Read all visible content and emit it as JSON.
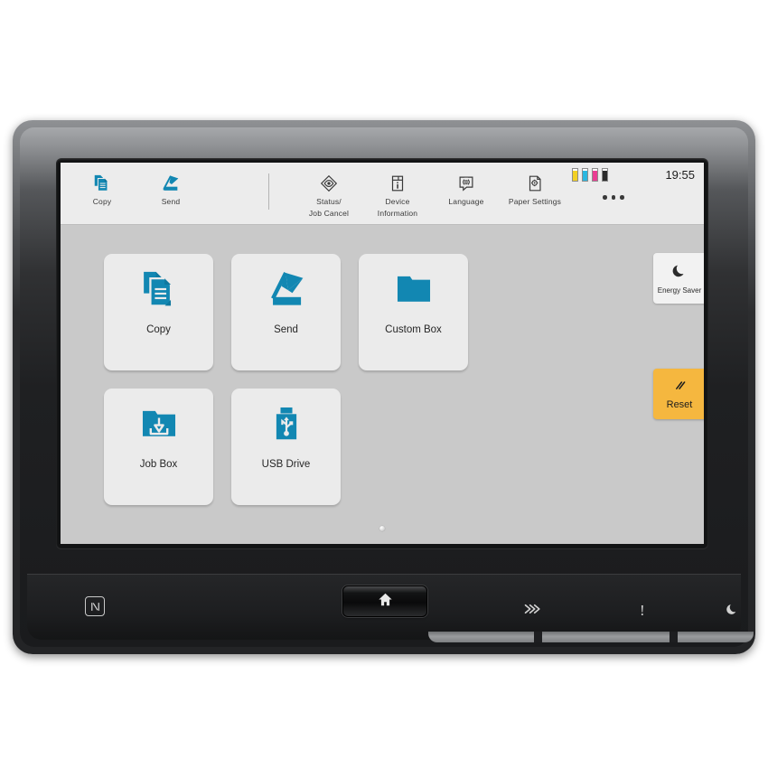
{
  "device": {
    "type": "mfp-touch-panel"
  },
  "screen": {
    "topbar": {
      "functions": [
        {
          "id": "copy",
          "label": "Copy",
          "icon": "copy-icon"
        },
        {
          "id": "send",
          "label": "Send",
          "icon": "send-icon"
        },
        {
          "id": "status",
          "label": "Status/",
          "label2": "Job Cancel",
          "icon": "status-job-cancel-icon"
        },
        {
          "id": "deviceinfo",
          "label": "Device",
          "label2": "Information",
          "icon": "device-information-icon"
        },
        {
          "id": "language",
          "label": "Language",
          "icon": "language-icon"
        },
        {
          "id": "papersettings",
          "label": "Paper Settings",
          "icon": "paper-settings-icon"
        }
      ],
      "more_label": "•••",
      "clock": "19:55",
      "toner": [
        {
          "name": "yellow",
          "color": "#f2d024",
          "level": 86
        },
        {
          "name": "cyan",
          "color": "#2bb7e0",
          "level": 86
        },
        {
          "name": "magenta",
          "color": "#ea3d93",
          "level": 86
        },
        {
          "name": "black",
          "color": "#2b2b2b",
          "level": 86
        }
      ]
    },
    "home": {
      "tiles": [
        {
          "id": "copy",
          "label": "Copy",
          "icon": "copy-icon"
        },
        {
          "id": "send",
          "label": "Send",
          "icon": "send-icon"
        },
        {
          "id": "custombox",
          "label": "Custom Box",
          "icon": "folder-icon"
        },
        {
          "id": "jobbox",
          "label": "Job Box",
          "icon": "job-box-icon"
        },
        {
          "id": "usbdrive",
          "label": "USB Drive",
          "icon": "usb-drive-icon"
        }
      ],
      "accent_color": "#1287b2",
      "tile_bg": "#ebebeb",
      "panel_bg": "#c9c9c9"
    },
    "rail": {
      "energy_saver": {
        "label": "Energy Saver",
        "icon": "moon-icon"
      },
      "reset": {
        "label": "Reset",
        "icon": "reset-slashes-icon",
        "color": "#f5b73f"
      }
    }
  },
  "hardware": {
    "nfc": {
      "label": "N",
      "icon": "nfc-icon"
    },
    "home_key": {
      "icon": "home-icon"
    },
    "indicators": [
      {
        "id": "processing",
        "icon": "processing-arrows-icon"
      },
      {
        "id": "attention",
        "icon": "attention-icon",
        "label": "!"
      },
      {
        "id": "sleep",
        "icon": "sleep-moon-icon"
      }
    ]
  }
}
